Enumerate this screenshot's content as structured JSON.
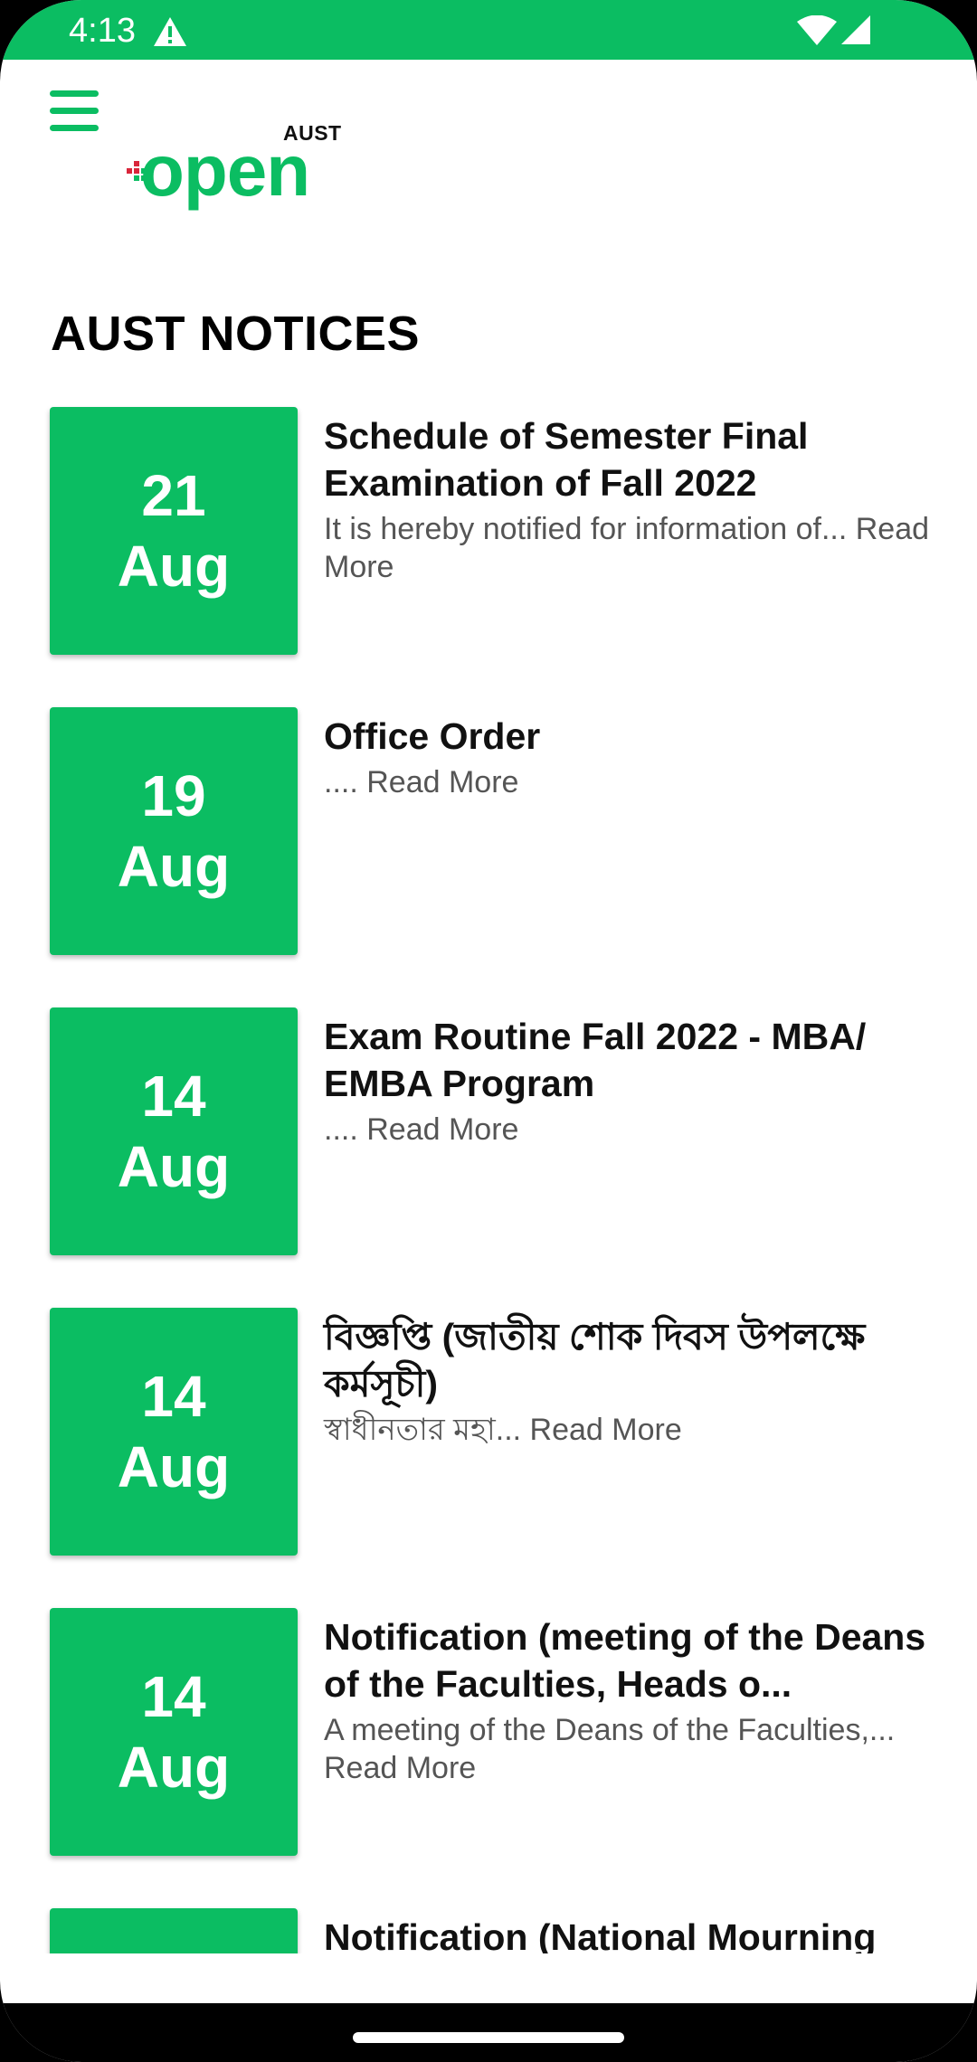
{
  "status_bar": {
    "time": "4:13",
    "warning_icon": "warning-icon",
    "wifi_icon": "wifi-icon",
    "signal_icon": "signal-icon",
    "color": "#0bbd62"
  },
  "header": {
    "menu_icon": "menu-icon",
    "logo_super": "AUST",
    "logo_word": "open",
    "accent_color": "#0bbd62"
  },
  "page_title": "AUST NOTICES",
  "notices": [
    {
      "day": "21",
      "month": "Aug",
      "title": "Schedule of Semester Final Examination of Fall 2022",
      "desc": "It is hereby notified for information of... Read More"
    },
    {
      "day": "19",
      "month": "Aug",
      "title": "Office Order",
      "desc": ".... Read More"
    },
    {
      "day": "14",
      "month": "Aug",
      "title": "Exam Routine Fall 2022 - MBA/ EMBA Program",
      "desc": ".... Read More"
    },
    {
      "day": "14",
      "month": "Aug",
      "title": "বিজ্ঞপ্তি (জাতীয় শোক দিবস উপলক্ষে কর্মসূচী)",
      "desc": "স্বাধীনতার মহা... Read More"
    },
    {
      "day": "14",
      "month": "Aug",
      "title": "Notification (meeting of the Deans of the Faculties, Heads o...",
      "desc": "A meeting of the Deans of the Faculties,... Read More"
    },
    {
      "day": "",
      "month": "",
      "title": "Notification (National Mourning",
      "desc": ""
    }
  ]
}
